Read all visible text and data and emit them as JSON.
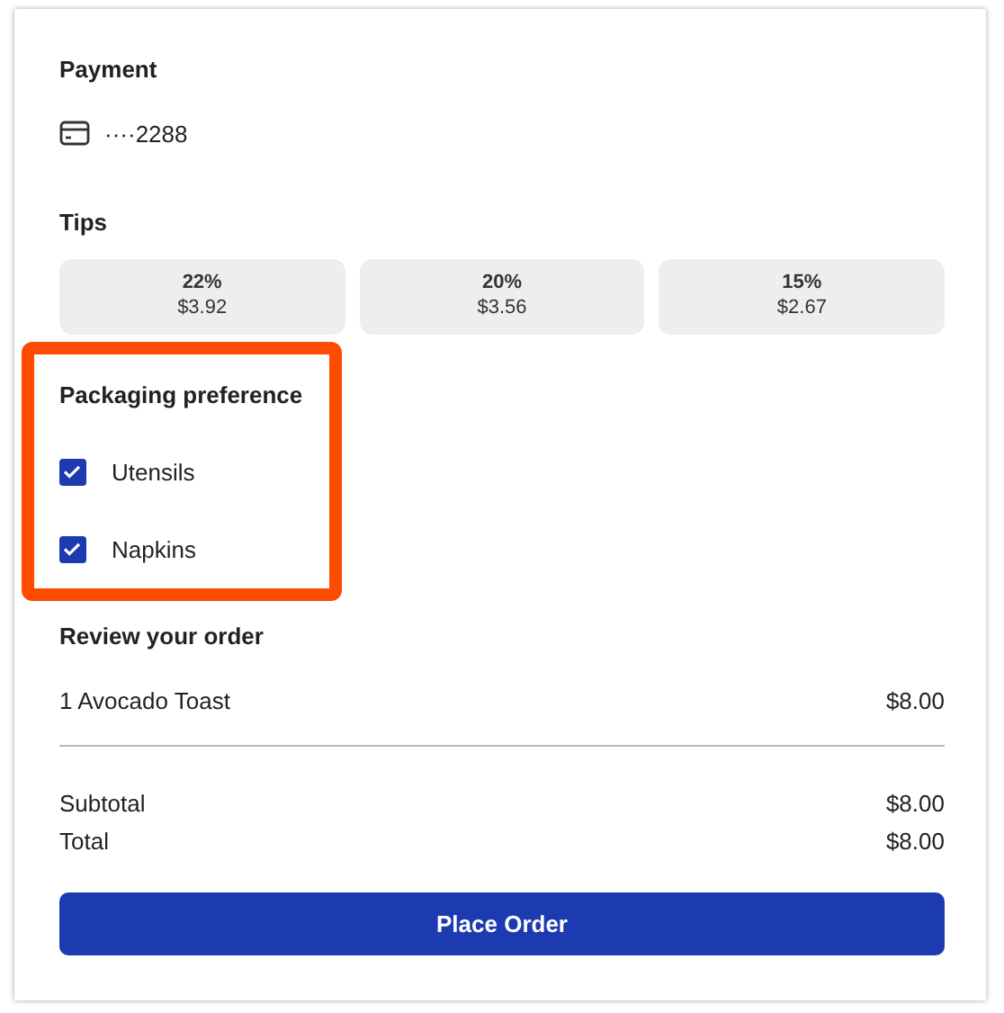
{
  "payment": {
    "title": "Payment",
    "card": "····2288"
  },
  "tips": {
    "title": "Tips",
    "options": [
      {
        "percent": "22%",
        "amount": "$3.92",
        "selected": false
      },
      {
        "percent": "20%",
        "amount": "$3.56",
        "selected": false
      },
      {
        "percent": "15%",
        "amount": "$2.67",
        "selected": false
      }
    ]
  },
  "packaging": {
    "title": "Packaging preference",
    "highlighted": true,
    "options": [
      {
        "label": "Utensils",
        "checked": true
      },
      {
        "label": "Napkins",
        "checked": true
      }
    ]
  },
  "review": {
    "title": "Review your order",
    "items": [
      {
        "name": "1 Avocado Toast",
        "price": "$8.00"
      }
    ],
    "totals": [
      {
        "label": "Subtotal",
        "value": "$8.00"
      },
      {
        "label": "Total",
        "value": "$8.00"
      }
    ]
  },
  "button": "Place Order"
}
